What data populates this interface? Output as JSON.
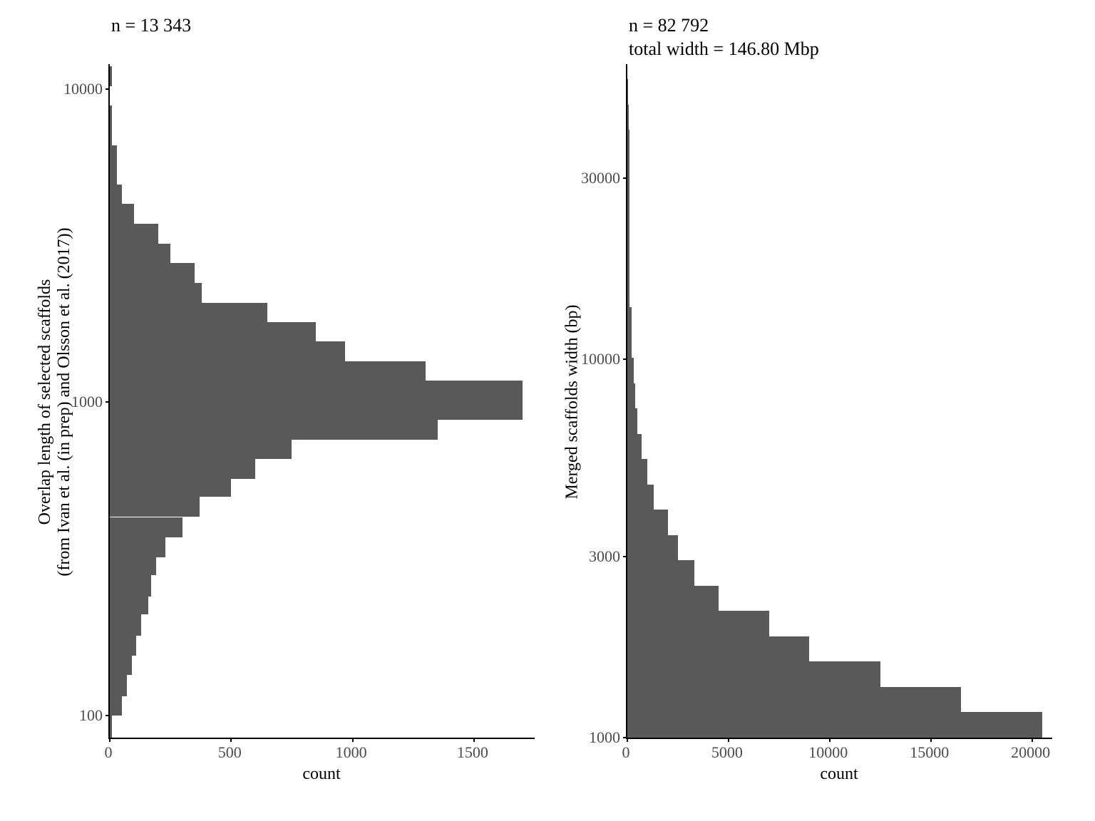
{
  "chart_data": [
    {
      "type": "bar",
      "orientation": "horizontal",
      "title_lines": [
        "n = 13 343"
      ],
      "xlabel": "count",
      "ylabel": "Overlap length of selected scaffolds\n(from Ivan et al. (in prep) and Olsson et al. (2017))",
      "xlim": [
        0,
        1750
      ],
      "x_ticks": [
        0,
        500,
        1000,
        1500
      ],
      "y_scale": "log10",
      "ylim": [
        85,
        12000
      ],
      "y_ticks": [
        100,
        1000,
        10000
      ],
      "bins": [
        {
          "lo": 85,
          "hi": 100,
          "count": 10
        },
        {
          "lo": 100,
          "hi": 115,
          "count": 50
        },
        {
          "lo": 115,
          "hi": 135,
          "count": 70
        },
        {
          "lo": 135,
          "hi": 155,
          "count": 90
        },
        {
          "lo": 155,
          "hi": 180,
          "count": 110
        },
        {
          "lo": 180,
          "hi": 210,
          "count": 130
        },
        {
          "lo": 210,
          "hi": 240,
          "count": 160
        },
        {
          "lo": 240,
          "hi": 280,
          "count": 170
        },
        {
          "lo": 280,
          "hi": 320,
          "count": 190
        },
        {
          "lo": 320,
          "hi": 370,
          "count": 230
        },
        {
          "lo": 370,
          "hi": 430,
          "count": 300
        },
        {
          "lo": 430,
          "hi": 500,
          "count": 370
        },
        {
          "lo": 500,
          "hi": 570,
          "count": 500
        },
        {
          "lo": 570,
          "hi": 660,
          "count": 600
        },
        {
          "lo": 660,
          "hi": 760,
          "count": 750
        },
        {
          "lo": 760,
          "hi": 880,
          "count": 1350
        },
        {
          "lo": 880,
          "hi": 1000,
          "count": 1700
        },
        {
          "lo": 1000,
          "hi": 1170,
          "count": 1700
        },
        {
          "lo": 1170,
          "hi": 1350,
          "count": 1300
        },
        {
          "lo": 1350,
          "hi": 1560,
          "count": 970
        },
        {
          "lo": 1560,
          "hi": 1800,
          "count": 850
        },
        {
          "lo": 1800,
          "hi": 2080,
          "count": 650
        },
        {
          "lo": 2080,
          "hi": 2400,
          "count": 380
        },
        {
          "lo": 2400,
          "hi": 2780,
          "count": 350
        },
        {
          "lo": 2780,
          "hi": 3210,
          "count": 250
        },
        {
          "lo": 3210,
          "hi": 3710,
          "count": 200
        },
        {
          "lo": 3710,
          "hi": 4290,
          "count": 100
        },
        {
          "lo": 4290,
          "hi": 4960,
          "count": 50
        },
        {
          "lo": 4960,
          "hi": 5730,
          "count": 30
        },
        {
          "lo": 5730,
          "hi": 6620,
          "count": 30
        },
        {
          "lo": 6620,
          "hi": 7650,
          "count": 10
        },
        {
          "lo": 7650,
          "hi": 8840,
          "count": 10
        },
        {
          "lo": 8840,
          "hi": 10220,
          "count": 0
        },
        {
          "lo": 10220,
          "hi": 11800,
          "count": 10
        }
      ]
    },
    {
      "type": "bar",
      "orientation": "horizontal",
      "title_lines": [
        "n = 82 792",
        "total width = 146.80 Mbp"
      ],
      "xlabel": "count",
      "ylabel": "Merged scaffolds width (bp)",
      "xlim": [
        0,
        21000
      ],
      "x_ticks": [
        0,
        5000,
        10000,
        15000,
        20000
      ],
      "y_scale": "log10",
      "ylim": [
        1000,
        60000
      ],
      "y_ticks": [
        1000,
        3000,
        10000,
        30000
      ],
      "bins": [
        {
          "lo": 1000,
          "hi": 1170,
          "count": 20500
        },
        {
          "lo": 1170,
          "hi": 1360,
          "count": 16500
        },
        {
          "lo": 1360,
          "hi": 1590,
          "count": 12500
        },
        {
          "lo": 1590,
          "hi": 1850,
          "count": 9000
        },
        {
          "lo": 1850,
          "hi": 2160,
          "count": 7000
        },
        {
          "lo": 2160,
          "hi": 2520,
          "count": 4500
        },
        {
          "lo": 2520,
          "hi": 2940,
          "count": 3300
        },
        {
          "lo": 2940,
          "hi": 3430,
          "count": 2500
        },
        {
          "lo": 3430,
          "hi": 4000,
          "count": 2000
        },
        {
          "lo": 4000,
          "hi": 4660,
          "count": 1300
        },
        {
          "lo": 4660,
          "hi": 5440,
          "count": 1000
        },
        {
          "lo": 5440,
          "hi": 6340,
          "count": 700
        },
        {
          "lo": 6340,
          "hi": 7400,
          "count": 500
        },
        {
          "lo": 7400,
          "hi": 8630,
          "count": 400
        },
        {
          "lo": 8630,
          "hi": 10070,
          "count": 300
        },
        {
          "lo": 10070,
          "hi": 11740,
          "count": 200
        },
        {
          "lo": 11740,
          "hi": 13700,
          "count": 200
        },
        {
          "lo": 13700,
          "hi": 15980,
          "count": 100
        },
        {
          "lo": 15980,
          "hi": 18640,
          "count": 100
        },
        {
          "lo": 18640,
          "hi": 21740,
          "count": 100
        },
        {
          "lo": 21740,
          "hi": 25360,
          "count": 100
        },
        {
          "lo": 25360,
          "hi": 29580,
          "count": 100
        },
        {
          "lo": 29580,
          "hi": 34500,
          "count": 100
        },
        {
          "lo": 34500,
          "hi": 40250,
          "count": 100
        },
        {
          "lo": 40250,
          "hi": 46950,
          "count": 80
        },
        {
          "lo": 46950,
          "hi": 54760,
          "count": 50
        }
      ]
    }
  ],
  "colors": {
    "bar_fill": "#595959",
    "axis": "#000000",
    "tick_text": "#4c4c4c"
  }
}
